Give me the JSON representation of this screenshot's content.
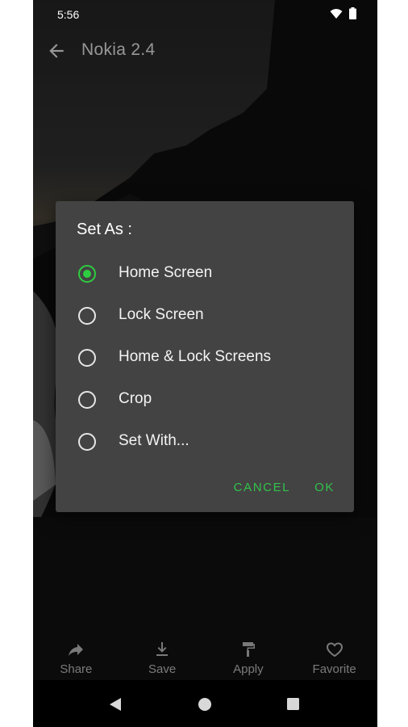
{
  "status_bar": {
    "time": "5:56"
  },
  "app_bar": {
    "title": "Nokia 2.4"
  },
  "dialog": {
    "title": "Set As :",
    "options": [
      {
        "label": "Home Screen",
        "selected": true
      },
      {
        "label": "Lock Screen",
        "selected": false
      },
      {
        "label": "Home & Lock Screens",
        "selected": false
      },
      {
        "label": "Crop",
        "selected": false
      },
      {
        "label": "Set With...",
        "selected": false
      }
    ],
    "cancel_label": "CANCEL",
    "ok_label": "OK"
  },
  "bottom_actions": [
    {
      "label": "Share",
      "icon": "share-icon"
    },
    {
      "label": "Save",
      "icon": "download-icon"
    },
    {
      "label": "Apply",
      "icon": "paint-roller-icon"
    },
    {
      "label": "Favorite",
      "icon": "heart-icon"
    }
  ],
  "colors": {
    "accent": "#2ecc40",
    "dialog_bg": "#434343"
  }
}
